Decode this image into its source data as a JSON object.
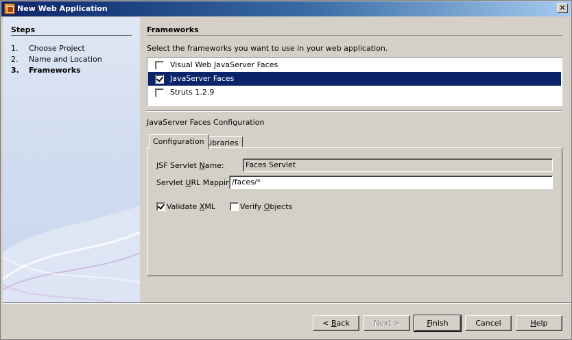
{
  "window": {
    "title": "New Web Application",
    "close_glyph": "✕"
  },
  "steps": {
    "heading": "Steps",
    "items": [
      {
        "num": "1.",
        "label": "Choose Project"
      },
      {
        "num": "2.",
        "label": "Name and Location"
      },
      {
        "num": "3.",
        "label": "Frameworks",
        "current": true
      }
    ]
  },
  "frameworks": {
    "heading": "Frameworks",
    "instruction": "Select the frameworks you want to use in your web application.",
    "items": [
      {
        "label": "Visual Web JavaServer Faces",
        "checked": false,
        "selected": false
      },
      {
        "label": "JavaServer Faces",
        "checked": true,
        "selected": true
      },
      {
        "label": "Struts 1.2.9",
        "checked": false,
        "selected": false
      }
    ]
  },
  "config": {
    "title": "JavaServer Faces Configuration",
    "tabs": [
      "Configuration",
      "Libraries"
    ],
    "servlet_name_label_a": "JSF Servlet ",
    "servlet_name_label_u": "N",
    "servlet_name_label_b": "ame:",
    "servlet_name_value": "Faces Servlet",
    "url_mapping_label_a": "Servlet ",
    "url_mapping_label_u": "U",
    "url_mapping_label_b": "RL Mapping:",
    "url_mapping_value": "/faces/*",
    "validate_xml_label_a": "Validate ",
    "validate_xml_label_u": "X",
    "validate_xml_label_b": "ML",
    "validate_xml_checked": true,
    "verify_objects_label_a": "Verify ",
    "verify_objects_label_u": "O",
    "verify_objects_label_b": "bjects",
    "verify_objects_checked": false
  },
  "buttons": {
    "back_u": "< ",
    "back_ul": "B",
    "back_rest": "ack",
    "next": "Next >",
    "finish_u": "F",
    "finish_rest": "inish",
    "cancel": "Cancel",
    "help_u": "H",
    "help_rest": "elp"
  },
  "colors": {
    "selection": "#0a246a",
    "dialog_bg": "#d4d0c8"
  }
}
